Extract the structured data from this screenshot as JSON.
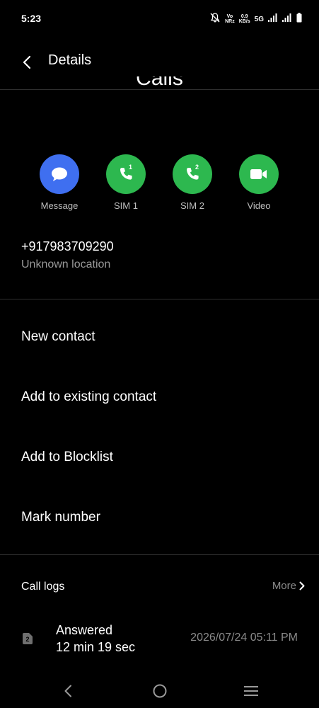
{
  "status_bar": {
    "time": "5:23",
    "volte_label_top": "Vo",
    "volte_label_bottom": "NRz",
    "speed_value": "0.9",
    "speed_unit": "KB/s",
    "network_type": "5G"
  },
  "header": {
    "title": "Details",
    "contact_name_partial": "Calls"
  },
  "actions": [
    {
      "label": "Message",
      "color": "#3f6ff0",
      "icon": "message-icon"
    },
    {
      "label": "SIM 1",
      "color": "#2db84f",
      "icon": "phone-sim1-icon",
      "badge": "1"
    },
    {
      "label": "SIM 2",
      "color": "#2db84f",
      "icon": "phone-sim2-icon",
      "badge": "2"
    },
    {
      "label": "Video",
      "color": "#2db84f",
      "icon": "video-icon"
    }
  ],
  "contact": {
    "phone_number": "+917983709290",
    "location": "Unknown location"
  },
  "menu": {
    "new_contact": "New contact",
    "add_existing": "Add to existing contact",
    "add_blocklist": "Add to Blocklist",
    "mark_number": "Mark number"
  },
  "call_logs": {
    "title": "Call logs",
    "more_label": "More",
    "entries": [
      {
        "status": "Answered",
        "duration": "12 min 19 sec",
        "date": "2026/07/24 05:11 PM",
        "sim": "2"
      }
    ]
  },
  "colors": {
    "background": "#000000",
    "message_blue": "#3f6ff0",
    "call_green": "#2db84f"
  }
}
